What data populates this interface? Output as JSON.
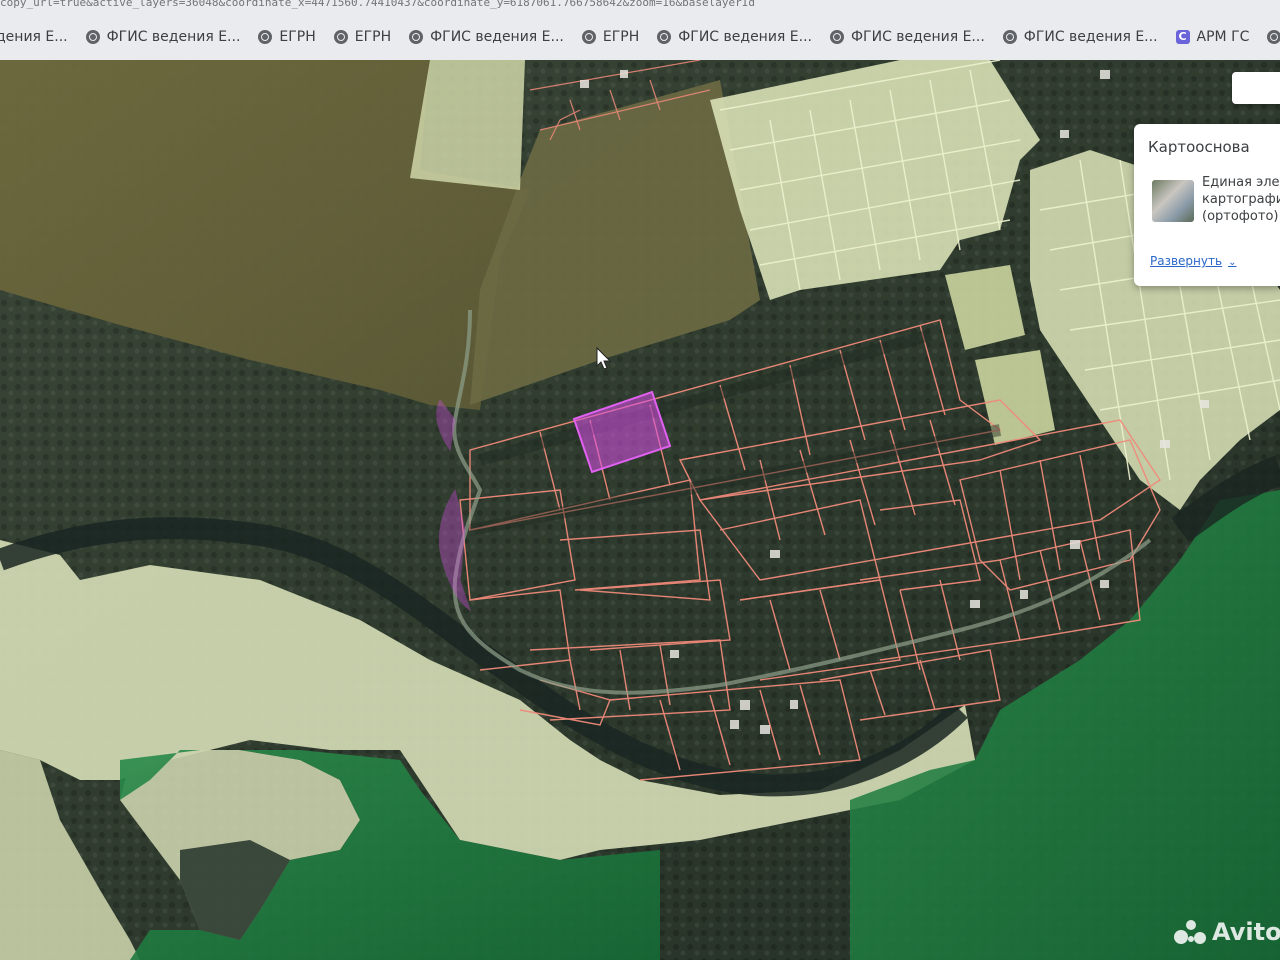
{
  "browser": {
    "url_fragment": "copy_url=true&active_layers=36048&coordinate_x=4471560.74410437&coordinate_y=6187061.766758642&zoom=16&baselayerId",
    "bookmarks": [
      {
        "label": "дения Е...",
        "icon": "globe-icon"
      },
      {
        "label": "ФГИС ведения Е...",
        "icon": "globe-icon"
      },
      {
        "label": "ЕГРН",
        "icon": "globe-icon"
      },
      {
        "label": "ЕГРН",
        "icon": "globe-icon"
      },
      {
        "label": "ФГИС ведения Е...",
        "icon": "globe-icon"
      },
      {
        "label": "ЕГРН",
        "icon": "globe-icon"
      },
      {
        "label": "ФГИС ведения Е...",
        "icon": "globe-icon"
      },
      {
        "label": "ФГИС ведения Е...",
        "icon": "globe-icon"
      },
      {
        "label": "ФГИС ведения Е...",
        "icon": "globe-icon"
      },
      {
        "label": "АРМ ГС",
        "icon": "app-c-icon"
      }
    ],
    "extra_icon": "globe-icon"
  },
  "basemap_panel": {
    "title": "Картооснова",
    "layer_line1": "Единая эле",
    "layer_line2": "картографи",
    "layer_line3": "(ортофото)",
    "expand_label": "Развернуть",
    "expand_icon": "chevron-down-icon"
  },
  "map": {
    "cursor_icon": "arrow-cursor-icon",
    "colors": {
      "forest_dark": "#2f3b2e",
      "field_olive": "#6c6a3f",
      "zone_pale": "#d8dfb8",
      "zone_green": "#1f7a3f",
      "parcel_line": "#f08a7a",
      "highlight": "#d94fe8",
      "river": "#1a2622"
    }
  },
  "watermark": {
    "text": "Avito",
    "icon": "avito-logo-icon"
  }
}
